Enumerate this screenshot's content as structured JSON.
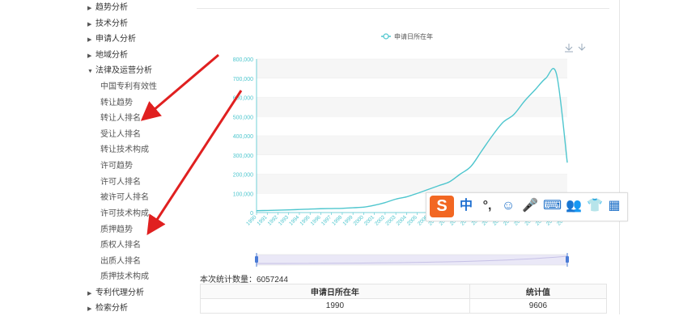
{
  "sidebar": {
    "top_items": [
      {
        "label": "趋势分析"
      },
      {
        "label": "技术分析"
      },
      {
        "label": "申请人分析"
      },
      {
        "label": "地域分析"
      },
      {
        "label": "法律及运营分析"
      }
    ],
    "sub_items": [
      {
        "label": "中国专利有效性"
      },
      {
        "label": "转让趋势"
      },
      {
        "label": "转让人排名"
      },
      {
        "label": "受让人排名"
      },
      {
        "label": "转让技术构成"
      },
      {
        "label": "许可趋势"
      },
      {
        "label": "许可人排名"
      },
      {
        "label": "被许可人排名"
      },
      {
        "label": "许可技术构成"
      },
      {
        "label": "质押趋势"
      },
      {
        "label": "质权人排名"
      },
      {
        "label": "出质人排名"
      },
      {
        "label": "质押技术构成"
      }
    ],
    "bottom_items": [
      {
        "label": "专利代理分析"
      },
      {
        "label": "检索分析"
      }
    ]
  },
  "chart_data": {
    "type": "line",
    "legend": "申请日所在年",
    "series": [
      {
        "name": "申请日所在年",
        "color": "#4ec6ce",
        "x": [
          "1990",
          "1991",
          "1992",
          "1993",
          "1994",
          "1995",
          "1996",
          "1997",
          "1998",
          "1999",
          "2000",
          "2001",
          "2002",
          "2003",
          "2004",
          "2005",
          "2006",
          "2007",
          "2008",
          "2009",
          "2010",
          "2011",
          "2012",
          "2013",
          "2014",
          "2015",
          "2016",
          "2017",
          "2018",
          "2019"
        ],
        "values": [
          9606,
          11000,
          12500,
          14000,
          16000,
          18000,
          20000,
          21000,
          22000,
          25000,
          28000,
          38000,
          52000,
          70000,
          82000,
          100000,
          120000,
          140000,
          160000,
          200000,
          240000,
          320000,
          400000,
          470000,
          510000,
          580000,
          640000,
          700000,
          720000,
          260000
        ]
      }
    ],
    "yticks": [
      "0",
      "100,000",
      "200,000",
      "300,000",
      "400,000",
      "500,000",
      "600,000",
      "700,000",
      "800,000"
    ],
    "ylim": [
      0,
      800000
    ]
  },
  "summary": {
    "count_label": "本次统计数量：6057244"
  },
  "table": {
    "headers": [
      "申请日所在年",
      "统计值"
    ],
    "rows": [
      [
        "1990",
        "9606"
      ]
    ]
  },
  "ime": {
    "logo": "S",
    "items": [
      "中",
      "°,",
      "☺",
      "🎤",
      "⌨",
      "👥",
      "👕",
      "▦"
    ]
  }
}
